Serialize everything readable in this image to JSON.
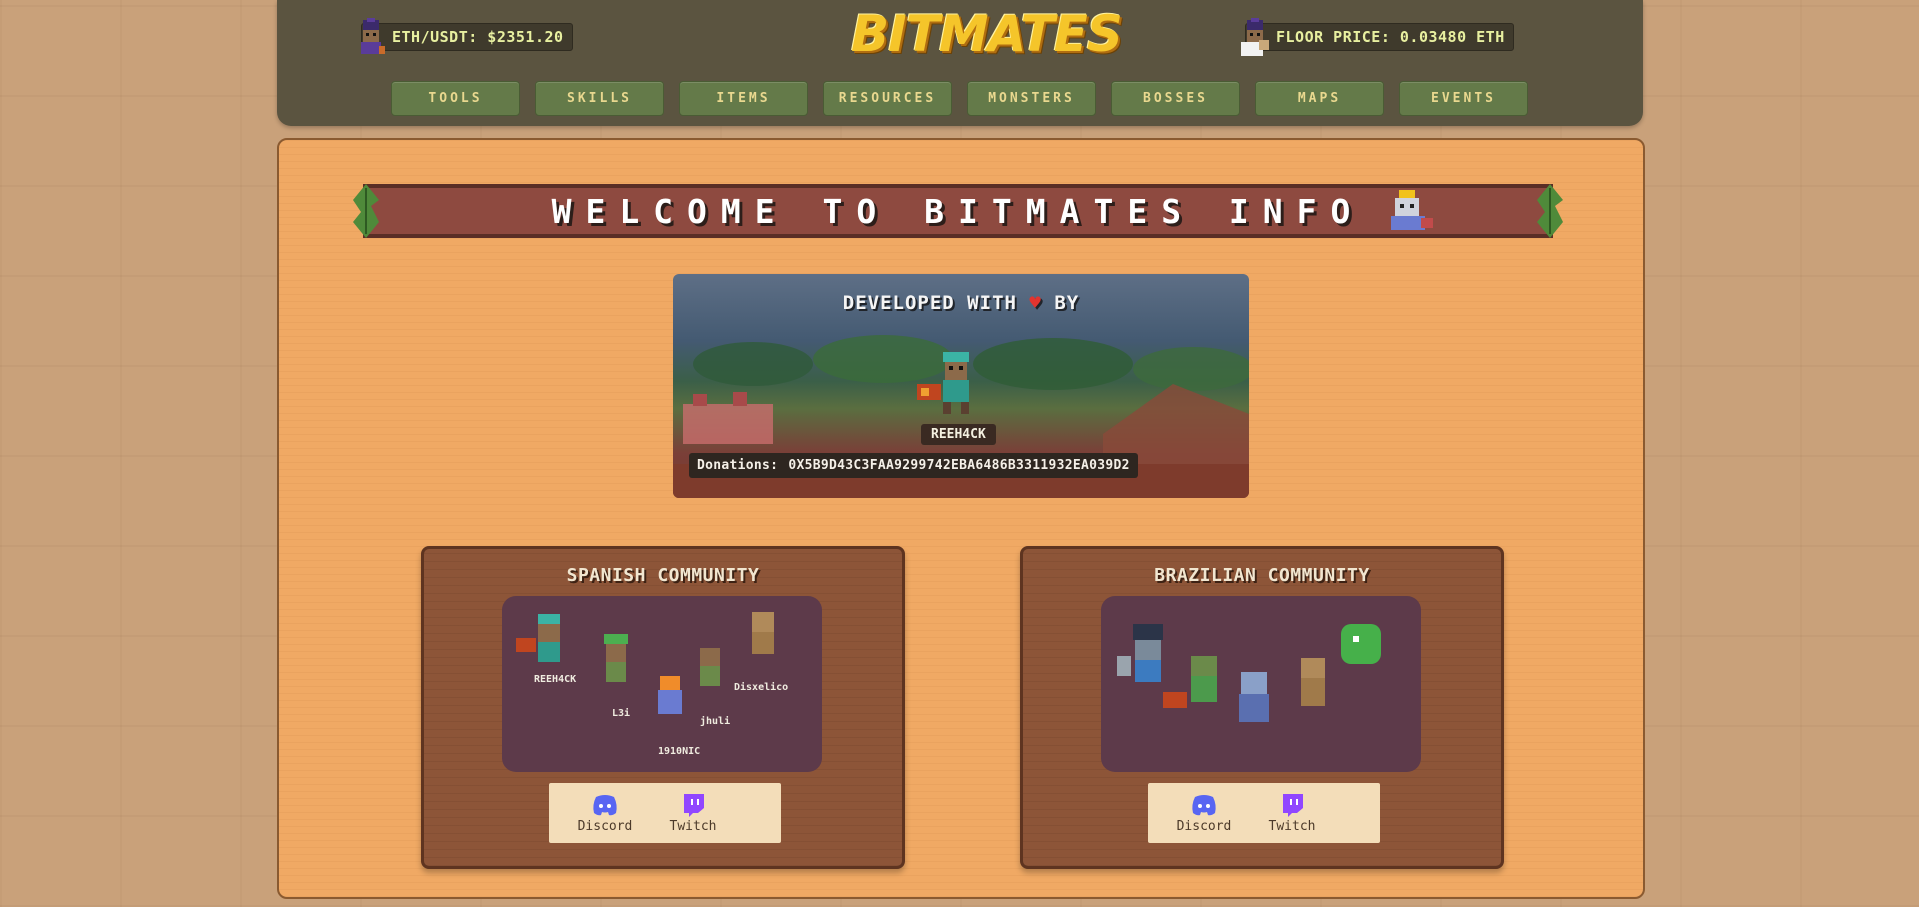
{
  "header": {
    "logo_text": "BITMATES",
    "eth_price": "ETH/USDT: $2351.20",
    "floor_price": "FLOOR PRICE: 0.03480 ETH",
    "nav": [
      "TOOLS",
      "SKILLS",
      "ITEMS",
      "RESOURCES",
      "MONSTERS",
      "BOSSES",
      "MAPS",
      "EVENTS"
    ]
  },
  "welcome": {
    "title": "WELCOME TO BITMATES INFO"
  },
  "developer": {
    "prefix": "DEVELOPED WITH",
    "suffix": "BY",
    "heart": "♥",
    "name": "REEH4CK",
    "donation_label": "Donations:",
    "donation_address": "0X5B9D43C3FAA9299742EBA6486B3311932EA039D2"
  },
  "spanish": {
    "title": "SPANISH COMMUNITY",
    "characters": [
      "REEH4CK",
      "L3i",
      "jhuli",
      "Disxelico",
      "1910NIC"
    ],
    "discord": "Discord",
    "twitch": "Twitch"
  },
  "brazilian": {
    "title": "BRAZILIAN COMMUNITY",
    "discord": "Discord",
    "twitch": "Twitch"
  },
  "colors": {
    "header_bg": "#5b5440",
    "nav_btn": "#647a49",
    "panel_bg": "#f0a964",
    "banner": "#8e4a40",
    "card_bg": "#8d5538",
    "discord": "#5865f2",
    "twitch": "#9146ff"
  }
}
